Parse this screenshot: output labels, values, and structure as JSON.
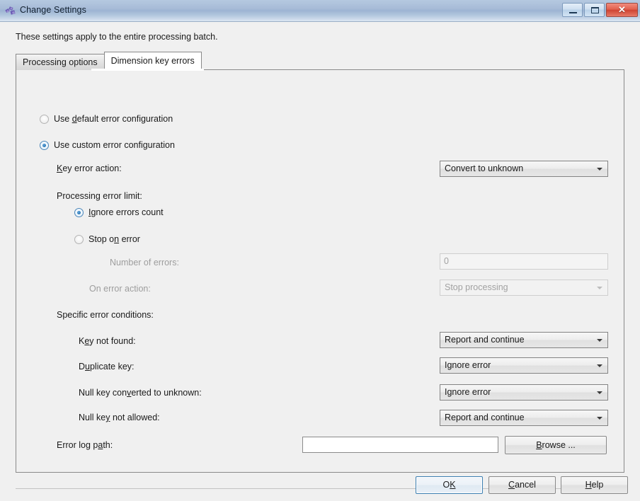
{
  "window": {
    "title": "Change Settings",
    "icon": "app-settings-icon",
    "controls": {
      "minimize": "minimize-icon",
      "maximize": "maximize-icon",
      "close": "close-icon",
      "close_glyph": "✕"
    }
  },
  "intro": "These settings apply to the entire processing batch.",
  "tabs": [
    {
      "label": "Processing options",
      "active": false
    },
    {
      "label": "Dimension key errors",
      "active": true
    }
  ],
  "config_mode": {
    "default_option": {
      "label_pre": "Use ",
      "accel": "d",
      "label_post": "efault error configuration",
      "selected": false
    },
    "custom_option": {
      "label": "Use custom error configuration",
      "selected": true
    }
  },
  "key_error_action": {
    "label_pre": "",
    "accel": "K",
    "label_post": "ey error action:",
    "value": "Convert to unknown",
    "enabled": true
  },
  "processing_error_limit": {
    "heading": "Processing error limit:",
    "ignore_errors_count": {
      "label_pre": "",
      "accel": "I",
      "label_post": "gnore errors count",
      "selected": true
    },
    "stop_on_error": {
      "label_pre": "Stop o",
      "accel": "n",
      "label_post": " error",
      "selected": false
    },
    "number_of_errors": {
      "label_pre": "Number",
      "accel": "_",
      "label_post": " of errors:",
      "label_plain": "Number of errors:",
      "value": "0",
      "enabled": false
    },
    "on_error_action": {
      "label_plain": "On error action:",
      "value": "Stop processing",
      "enabled": false
    }
  },
  "specific_error_conditions": {
    "heading": "Specific error conditions:",
    "items": [
      {
        "label_pre": "K",
        "accel": "e",
        "label_post": "y not found:",
        "value": "Report and continue"
      },
      {
        "label_pre": "D",
        "accel": "u",
        "label_post": "plicate key:",
        "value": "Ignore error"
      },
      {
        "label_pre": "Null key con",
        "accel": "v",
        "label_post": "erted to unknown:",
        "value": "Ignore error"
      },
      {
        "label_pre": "Null ke",
        "accel": "y",
        "label_post": " not allowed:",
        "value": "Report and continue"
      }
    ]
  },
  "error_log_path": {
    "label_pre": "Error log p",
    "accel": "a",
    "label_post": "th:",
    "value": "",
    "placeholder": "",
    "browse": {
      "label_pre": "",
      "accel": "B",
      "label_post": "rowse ..."
    }
  },
  "footer": {
    "ok": {
      "pre": "O",
      "accel": "K",
      "post": ""
    },
    "cancel": {
      "pre": "",
      "accel": "C",
      "post": "ancel"
    },
    "help": {
      "pre": "",
      "accel": "H",
      "post": "elp"
    }
  },
  "colors": {
    "accent": "#3c7fb1",
    "close_red": "#cf4433",
    "panel_bg": "#f0f0f0",
    "disabled_text": "#a2a2a2"
  }
}
